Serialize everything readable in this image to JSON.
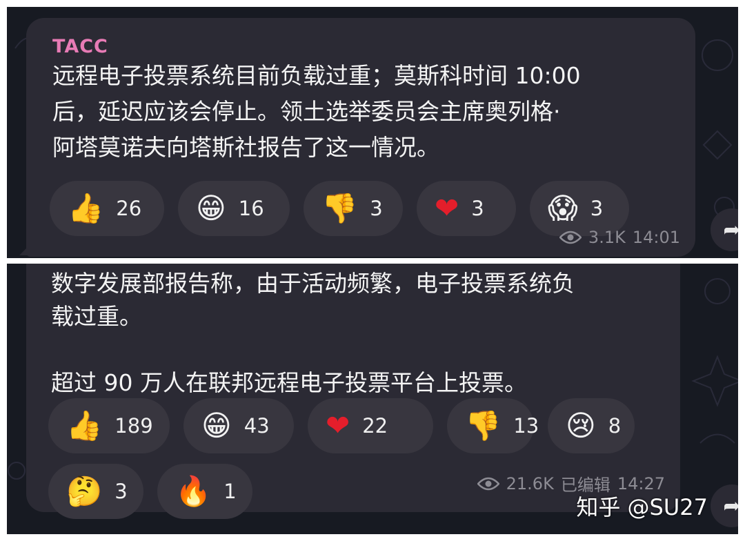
{
  "post1": {
    "sender": "TACC",
    "text": "远程电子投票系统目前负载过重；莫斯科时间 10:00\n后，延迟应该会停止。领土选举委员会主席奥列格·\n阿塔莫诺夫向塔斯社报告了这一情况。",
    "reactions": [
      {
        "emoji": "👍",
        "icon": "thumbs-up-icon",
        "count": "26"
      },
      {
        "emoji": "😁",
        "icon": "grinning-face-icon",
        "count": "16"
      },
      {
        "emoji": "👎",
        "icon": "thumbs-down-icon",
        "count": "3"
      },
      {
        "emoji": "❤",
        "icon": "heart-icon",
        "count": "3"
      },
      {
        "emoji": "😱",
        "icon": "screaming-face-icon",
        "count": "3"
      }
    ],
    "views": "3.1K",
    "time": "14:01"
  },
  "post2": {
    "text": "数字发展部报告称，由于活动频繁，电子投票系统负\n载过重。\n\n超过 90 万人在联邦远程电子投票平台上投票。",
    "reactions": [
      {
        "emoji": "👍",
        "icon": "thumbs-up-icon",
        "count": "189"
      },
      {
        "emoji": "😁",
        "icon": "grinning-face-icon",
        "count": "43"
      },
      {
        "emoji": "❤",
        "icon": "heart-icon",
        "count": "22"
      },
      {
        "emoji": "👎",
        "icon": "thumbs-down-icon",
        "count": "13"
      },
      {
        "emoji": "😢",
        "icon": "crying-face-icon",
        "count": "8"
      },
      {
        "emoji": "🤔",
        "icon": "thinking-face-icon",
        "count": "3"
      },
      {
        "emoji": "🔥",
        "icon": "fire-icon",
        "count": "1"
      }
    ],
    "views": "21.6K",
    "edited": "已编辑",
    "time": "14:27"
  },
  "watermark": "知乎 @SU27",
  "colors": {
    "background": "#171a22",
    "bubble": "#2b2a34",
    "sender": "#e77bb5",
    "pill": "#38363f"
  }
}
